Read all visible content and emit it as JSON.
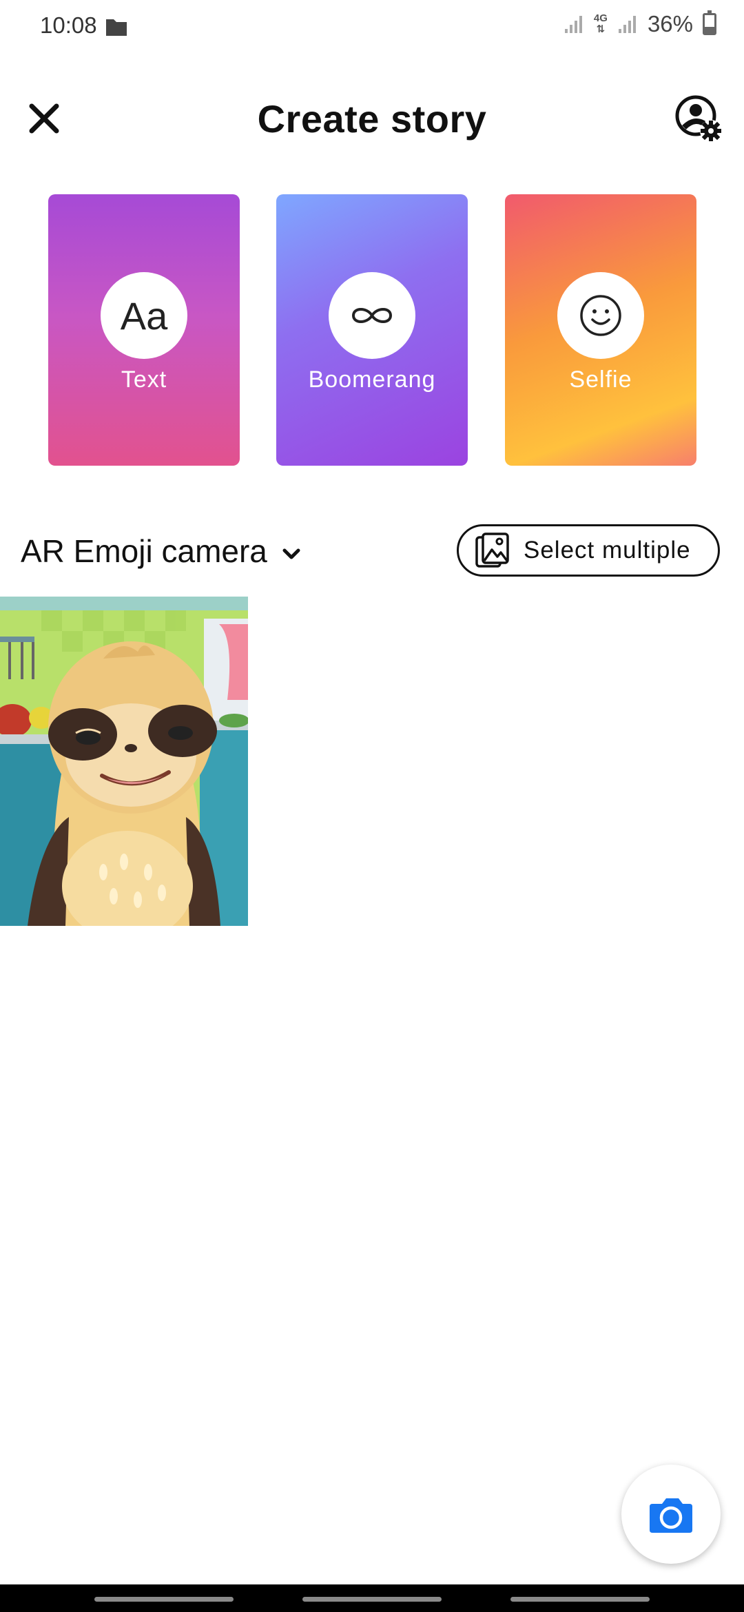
{
  "status_bar": {
    "time": "10:08",
    "network": "4G",
    "battery": "36%",
    "battery_level": 0.36
  },
  "header": {
    "title": "Create story"
  },
  "tiles": [
    {
      "label": "Text",
      "icon_glyph": "Aa",
      "icon": "text-icon"
    },
    {
      "label": "Boomerang",
      "icon": "infinity-icon"
    },
    {
      "label": "Selfie",
      "icon": "smiley-icon"
    }
  ],
  "album": {
    "selected": "AR Emoji camera",
    "select_multiple_label": "Select multiple"
  },
  "gallery": {
    "items": [
      {
        "type": "image",
        "description_icon": "sloth-emoji-thumbnail"
      }
    ]
  },
  "colors": {
    "accent_blue": "#1877f2",
    "text_tile": "#c857c4",
    "boomerang_tile": "#9b43e0",
    "selfie_tile": "#f99a3c"
  }
}
